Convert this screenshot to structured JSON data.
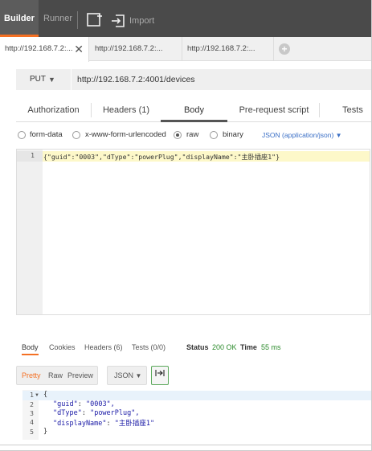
{
  "topbar": {
    "builder_label": "Builder",
    "runner_label": "Runner",
    "import_label": "Import",
    "new_icon": "new-tab-plus-icon",
    "import_icon": "import-icon",
    "accent": "#f47023"
  },
  "tabs": [
    {
      "label": "http://192.168.7.2:..."
    },
    {
      "label": "http://192.168.7.2:..."
    },
    {
      "label": "http://192.168.7.2:..."
    }
  ],
  "tab_close": "✕",
  "tab_add": "+",
  "request": {
    "method": "PUT",
    "url": "http://192.168.7.2:4001/devices"
  },
  "request_tabs": [
    {
      "label": "Authorization"
    },
    {
      "label": "Headers (1)"
    },
    {
      "label": "Body"
    },
    {
      "label": "Pre-request script"
    },
    {
      "label": "Tests"
    }
  ],
  "body_types": [
    {
      "label": "form-data"
    },
    {
      "label": "x-www-form-urlencoded"
    },
    {
      "label": "raw"
    },
    {
      "label": "binary"
    }
  ],
  "body_format": "JSON (application/json)",
  "editor": {
    "line_number": "1",
    "code": "{\"guid\":\"0003\",\"dType\":\"powerPlug\",\"displayName\":\"主卧插座1\"}"
  },
  "response_tabs": [
    {
      "label": "Body"
    },
    {
      "label": "Cookies"
    },
    {
      "label": "Headers (6)"
    },
    {
      "label": "Tests (0/0)"
    }
  ],
  "status": {
    "status_label": "Status",
    "status_value": "200 OK",
    "time_label": "Time",
    "time_value": "55 ms"
  },
  "view_modes": [
    {
      "label": "Pretty"
    },
    {
      "label": "Raw"
    },
    {
      "label": "Preview"
    }
  ],
  "response_format": "JSON",
  "wrap_icon": "wrap-lines-icon",
  "response_lines": [
    {
      "n": "1",
      "text": "{"
    },
    {
      "n": "2",
      "key": "\"guid\"",
      "value": "\"0003\","
    },
    {
      "n": "3",
      "key": "\"dType\"",
      "value": "\"powerPlug\","
    },
    {
      "n": "4",
      "key": "\"displayName\"",
      "value": "\"主卧插座1\""
    },
    {
      "n": "5",
      "text": "}"
    }
  ]
}
